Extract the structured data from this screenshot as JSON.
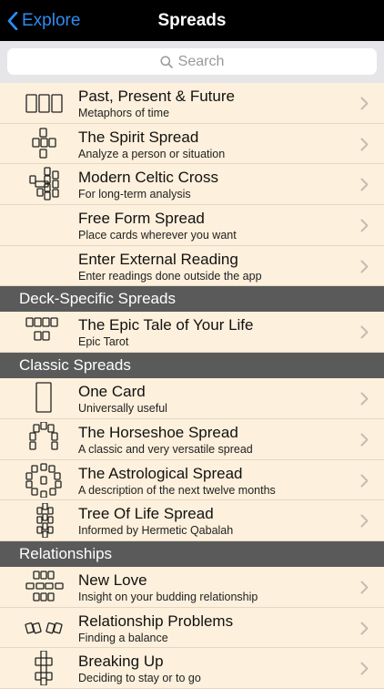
{
  "nav": {
    "back_label": "Explore",
    "title": "Spreads"
  },
  "search": {
    "placeholder": "Search"
  },
  "groups": [
    {
      "header": "",
      "rows": [
        {
          "title": "Past, Present & Future",
          "subtitle": "Metaphors of time",
          "icon": "three-cards-icon"
        },
        {
          "title": "The Spirit Spread",
          "subtitle": "Analyze a person or situation",
          "icon": "spirit-spread-icon"
        },
        {
          "title": "Modern Celtic Cross",
          "subtitle": "For long-term analysis",
          "icon": "celtic-cross-icon"
        },
        {
          "title": "Free Form Spread",
          "subtitle": "Place cards wherever you want",
          "icon": ""
        },
        {
          "title": "Enter External Reading",
          "subtitle": "Enter readings done outside the app",
          "icon": ""
        }
      ]
    },
    {
      "header": "Deck-Specific Spreads",
      "rows": [
        {
          "title": "The Epic Tale of Your Life",
          "subtitle": "Epic Tarot",
          "icon": "epic-tale-icon"
        }
      ]
    },
    {
      "header": "Classic Spreads",
      "rows": [
        {
          "title": "One Card",
          "subtitle": "Universally useful",
          "icon": "one-card-icon"
        },
        {
          "title": "The Horseshoe Spread",
          "subtitle": "A classic and very versatile spread",
          "icon": "horseshoe-icon"
        },
        {
          "title": "The Astrological Spread",
          "subtitle": "A description of the next twelve months",
          "icon": "astrological-icon"
        },
        {
          "title": "Tree Of Life Spread",
          "subtitle": "Informed by Hermetic Qabalah",
          "icon": "tree-of-life-icon"
        }
      ]
    },
    {
      "header": "Relationships",
      "rows": [
        {
          "title": "New Love",
          "subtitle": "Insight on your budding relationship",
          "icon": "new-love-icon"
        },
        {
          "title": "Relationship Problems",
          "subtitle": "Finding a balance",
          "icon": "relationship-problems-icon"
        },
        {
          "title": "Breaking Up",
          "subtitle": "Deciding to stay or to go",
          "icon": "breaking-up-icon"
        }
      ]
    }
  ]
}
